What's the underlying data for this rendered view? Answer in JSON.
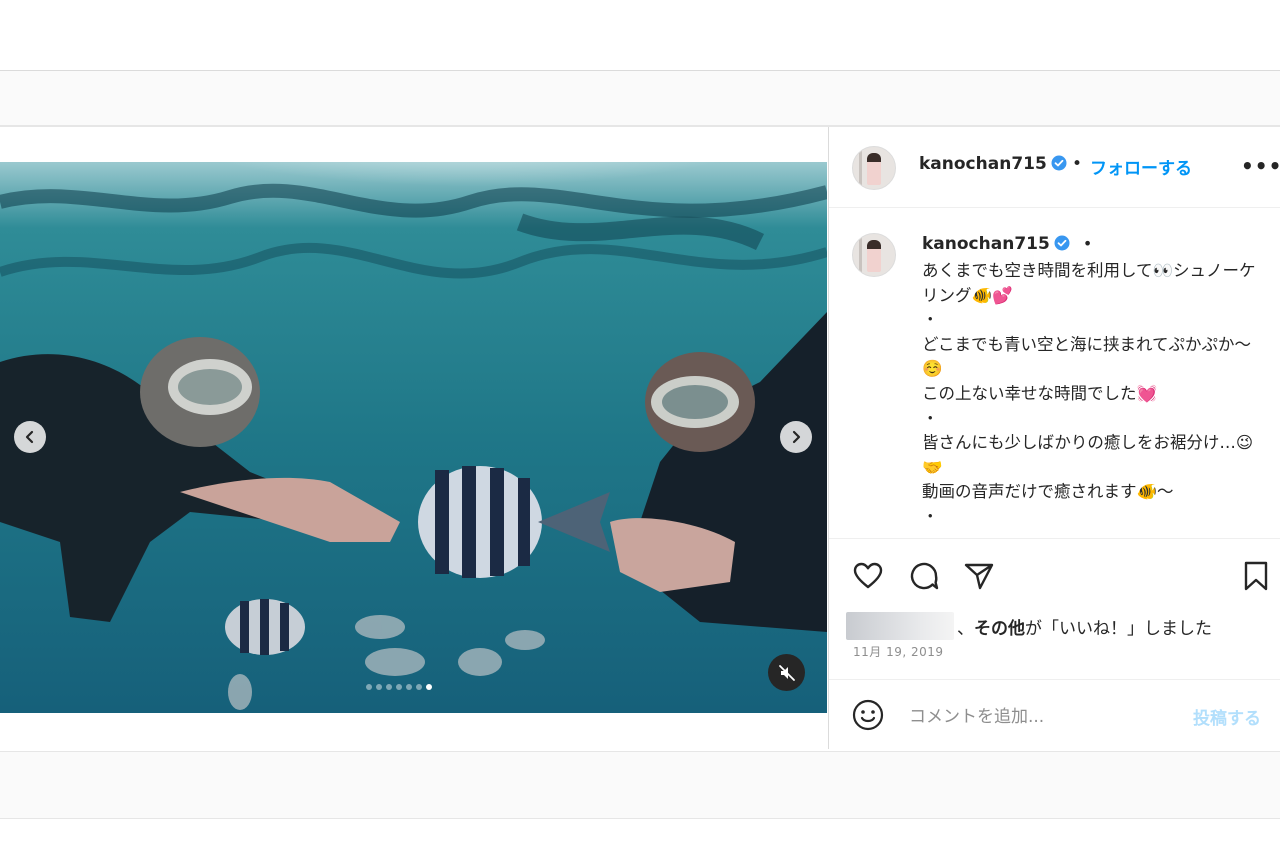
{
  "post": {
    "username": "kanochan715",
    "follow_label": "フォローする",
    "separator": "•",
    "more_label": "•••",
    "caption": {
      "username": "kanochan715",
      "separator": "•",
      "text": "あくまでも空き時間を利用して👀シュノーケリング🐠💕\n・\nどこまでも青い空と海に挟まれてぷかぷか〜☺️\nこの上ない幸せな時間でした💓\n・\n皆さんにも少しばかりの癒しをお裾分け…😉🤝\n動画の音声だけで癒されます🐠〜\n・"
    },
    "likes": {
      "others_label": "その他",
      "suffix": "が「いいね！」しました",
      "lead": "、"
    },
    "date": "11月 19, 2019",
    "comment": {
      "placeholder": "コメントを追加...",
      "post_label": "投稿する"
    }
  },
  "media": {
    "slide_count": 7,
    "active_slide": 6
  },
  "colors": {
    "accent": "#0095f6",
    "post_disabled": "#b2dffc",
    "water": "#1f6f7e"
  },
  "icons": [
    "chevron-left-icon",
    "chevron-right-icon",
    "muted-speaker-icon",
    "heart-icon",
    "comment-icon",
    "share-icon",
    "bookmark-icon",
    "smiley-icon",
    "verified-icon",
    "more-icon"
  ]
}
